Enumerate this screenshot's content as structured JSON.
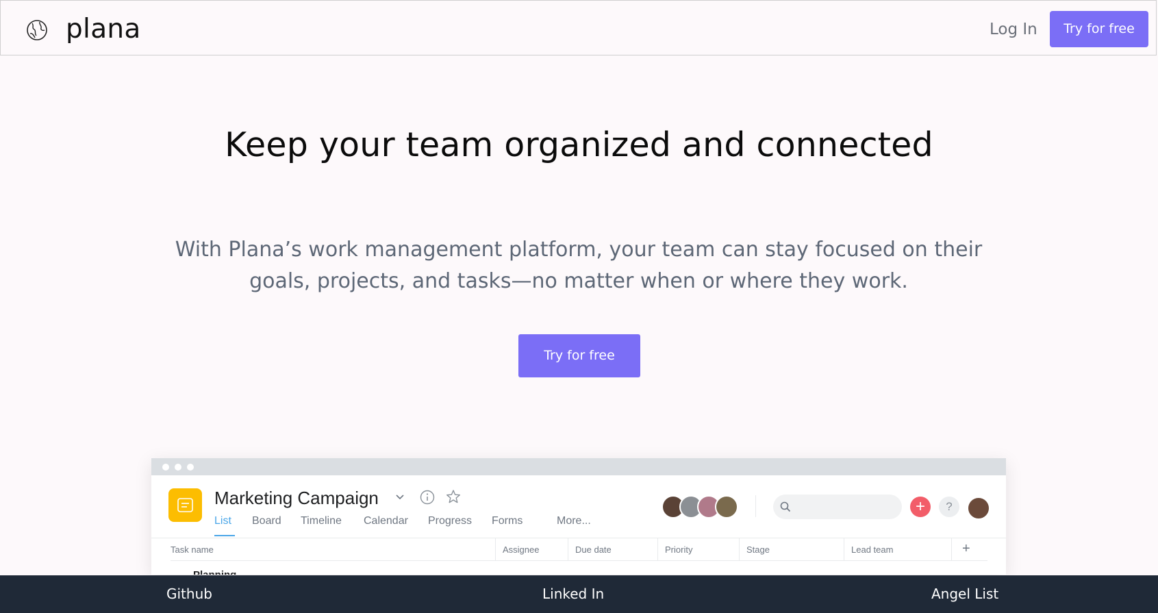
{
  "nav": {
    "brand": "plana",
    "login": "Log In",
    "try_free": "Try for free"
  },
  "hero": {
    "title": "Keep your team organized and connected",
    "subtitle_line1": "With Plana’s work management platform, your team can stay focused on their",
    "subtitle_line2": "goals, projects, and tasks—no matter when or where they work.",
    "cta": "Try for free"
  },
  "preview": {
    "project_title": "Marketing Campaign",
    "tabs": [
      {
        "label": "List",
        "active": true
      },
      {
        "label": "Board"
      },
      {
        "label": "Timeline"
      },
      {
        "label": "Calendar"
      },
      {
        "label": "Progress"
      },
      {
        "label": "Forms"
      },
      {
        "label": "More..."
      }
    ],
    "columns": [
      "Task name",
      "Assignee",
      "Due date",
      "Priority",
      "Stage",
      "Lead team"
    ],
    "add_column": "+",
    "partial_row": "Planning",
    "icons": [
      "list-icon",
      "chevron-down-icon",
      "info-icon",
      "star-icon",
      "search-icon",
      "plus-icon",
      "help-icon"
    ],
    "accent": "#4aa6e8",
    "app_icon_color": "#fcbd01"
  },
  "footer": {
    "links": [
      "Github",
      "Linked In",
      "Angel List"
    ]
  },
  "colors": {
    "primary_button": "#7b6ef6",
    "footer_bg": "#1f2937",
    "page_bg": "#fdf9fb",
    "subtitle_text": "#5d6776"
  }
}
